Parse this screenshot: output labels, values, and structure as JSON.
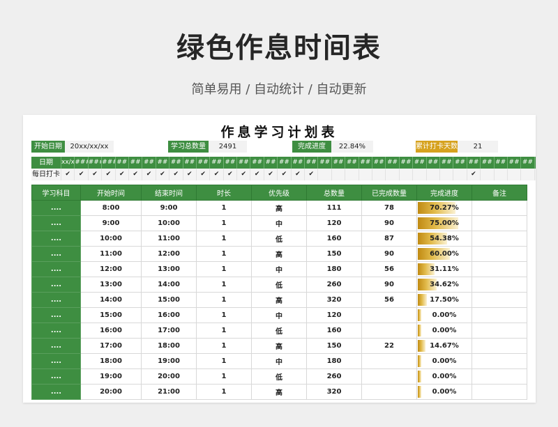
{
  "header": {
    "title": "绿色作息时间表",
    "subtitle": "简单易用 / 自动统计 / 自动更新"
  },
  "sheet": {
    "title": "作息学习计划表",
    "summary": [
      {
        "label": "开始日期",
        "value": "20xx/xx/xx"
      },
      {
        "label": "学习总数量",
        "value": "2491"
      },
      {
        "label": "完成进度",
        "value": "22.84%"
      },
      {
        "label": "累计打卡天数",
        "value": "21"
      }
    ],
    "strip": {
      "date_label": "日期",
      "check_label": "每日打卡",
      "dates": [
        "xx/xx",
        "###",
        "###",
        "###",
        "##",
        "##",
        "##",
        "##",
        "##",
        "##",
        "##",
        "##",
        "##",
        "##",
        "##",
        "##",
        "##",
        "##",
        "##",
        "##",
        "##",
        "##",
        "##",
        "##",
        "##",
        "##",
        "##",
        "##",
        "##",
        "##",
        "##",
        "##",
        "##",
        "##",
        "##",
        "##"
      ],
      "checks": [
        "✔",
        "✔",
        "✔",
        "✔",
        "✔",
        "✔",
        "✔",
        "✔",
        "✔",
        "✔",
        "✔",
        "✔",
        "✔",
        "✔",
        "✔",
        "✔",
        "✔",
        "✔",
        "✔",
        "",
        "",
        "",
        "",
        "",
        "",
        "",
        "",
        "",
        "",
        "",
        "✔",
        "",
        "",
        "",
        "",
        ""
      ]
    },
    "columns": [
      "学习科目",
      "开始时间",
      "结束时间",
      "时长",
      "优先级",
      "总数量",
      "已完成数量",
      "完成进度",
      "备注"
    ],
    "rows": [
      {
        "subject": "....",
        "start": "8:00",
        "end": "9:00",
        "duration": "1",
        "priority": "高",
        "total": "111",
        "done": "78",
        "progress": "70.27%",
        "note": ""
      },
      {
        "subject": "....",
        "start": "9:00",
        "end": "10:00",
        "duration": "1",
        "priority": "中",
        "total": "120",
        "done": "90",
        "progress": "75.00%",
        "note": ""
      },
      {
        "subject": "....",
        "start": "10:00",
        "end": "11:00",
        "duration": "1",
        "priority": "低",
        "total": "160",
        "done": "87",
        "progress": "54.38%",
        "note": ""
      },
      {
        "subject": "....",
        "start": "11:00",
        "end": "12:00",
        "duration": "1",
        "priority": "高",
        "total": "150",
        "done": "90",
        "progress": "60.00%",
        "note": ""
      },
      {
        "subject": "....",
        "start": "12:00",
        "end": "13:00",
        "duration": "1",
        "priority": "中",
        "total": "180",
        "done": "56",
        "progress": "31.11%",
        "note": ""
      },
      {
        "subject": "....",
        "start": "13:00",
        "end": "14:00",
        "duration": "1",
        "priority": "低",
        "total": "260",
        "done": "90",
        "progress": "34.62%",
        "note": ""
      },
      {
        "subject": "....",
        "start": "14:00",
        "end": "15:00",
        "duration": "1",
        "priority": "高",
        "total": "320",
        "done": "56",
        "progress": "17.50%",
        "note": ""
      },
      {
        "subject": "....",
        "start": "15:00",
        "end": "16:00",
        "duration": "1",
        "priority": "中",
        "total": "120",
        "done": "",
        "progress": "0.00%",
        "note": ""
      },
      {
        "subject": "....",
        "start": "16:00",
        "end": "17:00",
        "duration": "1",
        "priority": "低",
        "total": "160",
        "done": "",
        "progress": "0.00%",
        "note": ""
      },
      {
        "subject": "....",
        "start": "17:00",
        "end": "18:00",
        "duration": "1",
        "priority": "高",
        "total": "150",
        "done": "22",
        "progress": "14.67%",
        "note": ""
      },
      {
        "subject": "....",
        "start": "18:00",
        "end": "19:00",
        "duration": "1",
        "priority": "中",
        "total": "180",
        "done": "",
        "progress": "0.00%",
        "note": ""
      },
      {
        "subject": "....",
        "start": "19:00",
        "end": "20:00",
        "duration": "1",
        "priority": "低",
        "total": "260",
        "done": "",
        "progress": "0.00%",
        "note": ""
      },
      {
        "subject": "....",
        "start": "20:00",
        "end": "21:00",
        "duration": "1",
        "priority": "高",
        "total": "320",
        "done": "",
        "progress": "0.00%",
        "note": ""
      }
    ]
  },
  "colors": {
    "accent_green": "#3e8e41",
    "accent_gold": "#d6a21e",
    "progress_bar": "#c08a12"
  }
}
